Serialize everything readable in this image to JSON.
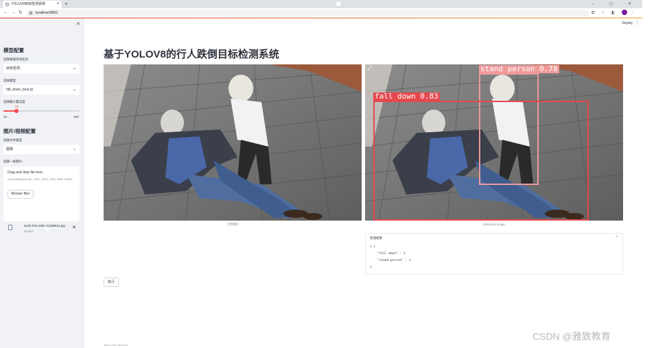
{
  "browser": {
    "tab_title": "YOLOV8目标检测系统",
    "url": "localhost:8501",
    "window_controls": "– ▢ ✕"
  },
  "sidebar": {
    "section1_title": "模型配置",
    "task_label": "选择要操作的任务",
    "task_value": "目标检测",
    "model_label": "选择模型",
    "model_value": "fall_down_best.pt",
    "conf_label": "选择最小置信度",
    "conf_value": "25",
    "conf_min": "10",
    "conf_max": "100",
    "conf_fraction": 0.17,
    "section2_title": "图片/视频配置",
    "source_label": "选择文件类型",
    "source_value": "图像",
    "upload_label": "选择一张图片...",
    "uploader_title": "Drag and drop file here",
    "uploader_hint": "Limit 200MB per file • JPG, JPEG, PNG, BMP, WEBP",
    "browse_label": "Browse files",
    "file_name": "stock-foto-elder-41268913.jpg",
    "file_size": "36.8KB"
  },
  "main": {
    "deploy_label": "Deploy",
    "title": "基于YOLOV8的行人跌倒目标检测系统",
    "caption_left": "上传图片",
    "caption_right": "Detected Image",
    "result_title": "检测结果",
    "result_json": "▾ [\n    \"fall down\" : 1\n    \"stand person\" : 1\n]",
    "run_label": "执行",
    "footer": "Made with Streamlit"
  },
  "detections": [
    {
      "label": "fall down 0.83",
      "class": "fall down",
      "confidence": 0.83
    },
    {
      "label": "stand person 0.78",
      "class": "stand person",
      "confidence": 0.78
    }
  ],
  "watermark": "CSDN @雅致教育",
  "colors": {
    "accent": "#ff4b4b",
    "sidebar_bg": "#f0f2f6",
    "box": "#e5484d"
  }
}
